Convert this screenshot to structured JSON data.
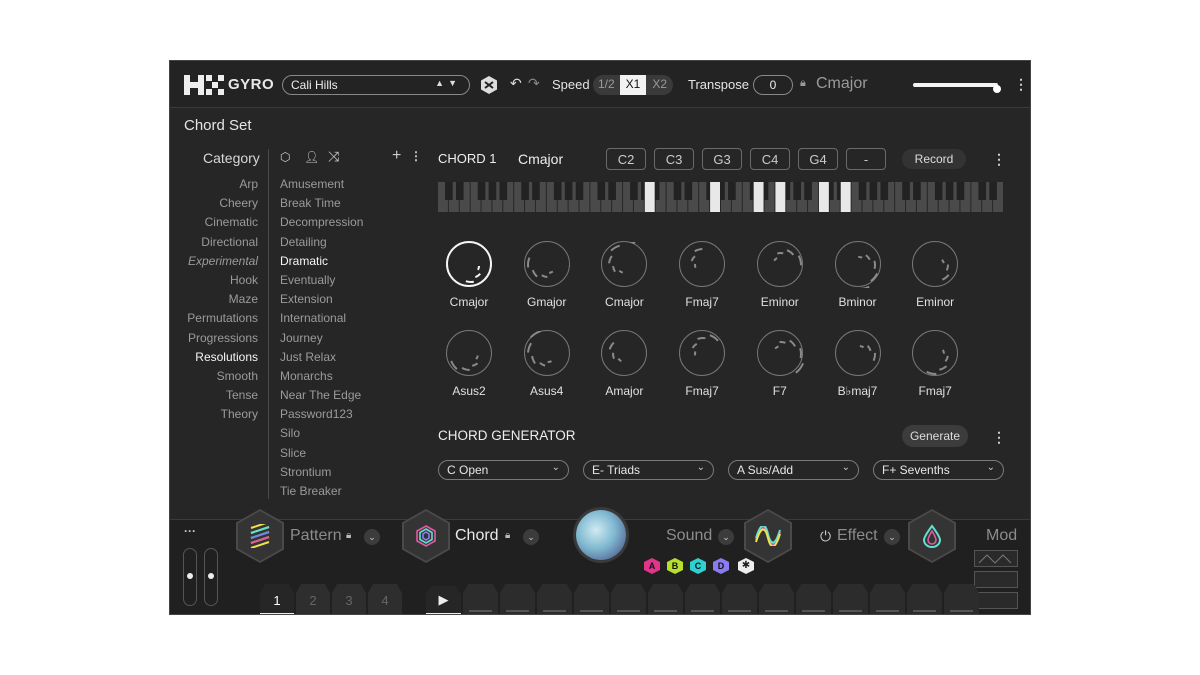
{
  "header": {
    "logo_text": "GYRO",
    "preset_name": "Cali Hills",
    "speed_label": "Speed",
    "speed_options": [
      "1/2",
      "X1",
      "X2"
    ],
    "speed_selected": "X1",
    "transpose_label": "Transpose",
    "transpose_value": "0",
    "key_label": "Cmajor",
    "volume_level": 0.95
  },
  "chord_set": {
    "title": "Chord Set",
    "category_label": "Category",
    "categories": [
      "Arp",
      "Cheery",
      "Cinematic",
      "Directional",
      "Experimental",
      "Hook",
      "Maze",
      "Permutations",
      "Progressions",
      "Resolutions",
      "Smooth",
      "Tense",
      "Theory"
    ],
    "selected_category": "Resolutions",
    "sets": [
      "Amusement",
      "Break Time",
      "Decompression",
      "Detailing",
      "Dramatic",
      "Eventually",
      "Extension",
      "International",
      "Journey",
      "Just Relax",
      "Monarchs",
      "Near The Edge",
      "Password123",
      "Silo",
      "Slice",
      "Strontium",
      "Tie Breaker"
    ],
    "selected_set": "Dramatic"
  },
  "chord_editor": {
    "chord_label": "CHORD 1",
    "chord_name": "Cmajor",
    "notes": [
      "C2",
      "C3",
      "G3",
      "C4",
      "G4",
      "-"
    ],
    "record_label": "Record",
    "active_keys_percent": [
      0.36,
      0.48,
      0.55,
      0.6,
      0.67,
      0.72
    ]
  },
  "chords": [
    {
      "name": "Cmajor",
      "selected": true
    },
    {
      "name": "Gmajor",
      "selected": false
    },
    {
      "name": "Cmajor",
      "selected": false
    },
    {
      "name": "Fmaj7",
      "selected": false
    },
    {
      "name": "Eminor",
      "selected": false
    },
    {
      "name": "Bminor",
      "selected": false
    },
    {
      "name": "Eminor",
      "selected": false
    },
    {
      "name": "Asus2",
      "selected": false
    },
    {
      "name": "Asus4",
      "selected": false
    },
    {
      "name": "Amajor",
      "selected": false
    },
    {
      "name": "Fmaj7",
      "selected": false
    },
    {
      "name": "F7",
      "selected": false
    },
    {
      "name": "B♭maj7",
      "selected": false
    },
    {
      "name": "Fmaj7",
      "selected": false
    }
  ],
  "generator": {
    "title": "CHORD GENERATOR",
    "button": "Generate",
    "dropdowns": [
      "C  Open",
      "E-  Triads",
      "A  Sus/Add",
      "F+  Sevenths"
    ]
  },
  "bottom": {
    "more": "···",
    "pattern_label": "Pattern",
    "chord_label": "Chord",
    "sound_label": "Sound",
    "effect_label": "Effect",
    "mod_label": "Mod",
    "pattern_tabs": [
      "1",
      "2",
      "3",
      "4"
    ],
    "selected_tab": "1",
    "step_count": 14,
    "macros": [
      {
        "label": "A",
        "color": "#e0358b"
      },
      {
        "label": "B",
        "color": "#b6e02d"
      },
      {
        "label": "C",
        "color": "#2fd0d0"
      },
      {
        "label": "D",
        "color": "#8a7bf0"
      }
    ]
  }
}
